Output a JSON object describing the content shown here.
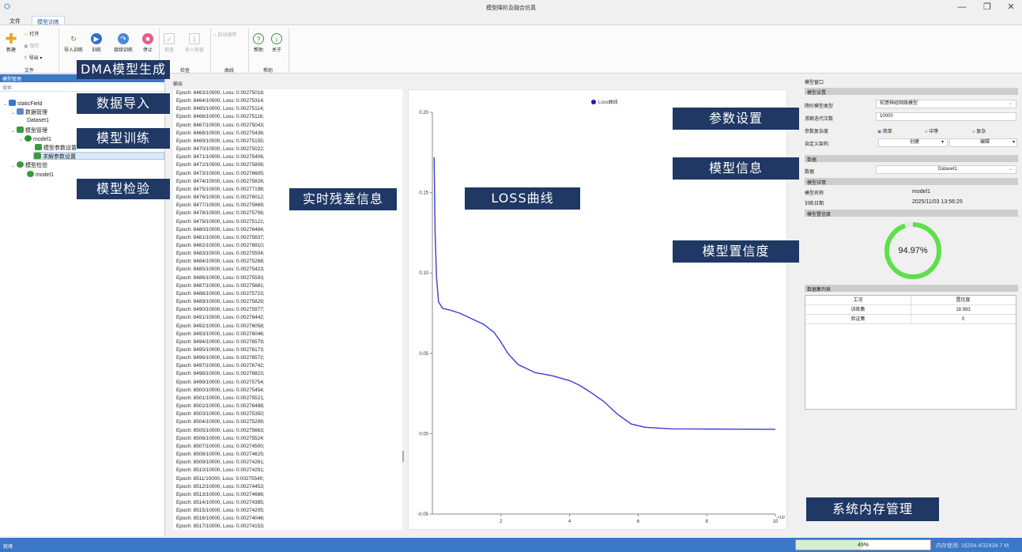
{
  "window": {
    "title": "模型降阶及融合仿真",
    "minimize": "—",
    "maximize": "❐",
    "close": "✕"
  },
  "menu": {
    "tabs": [
      "文件",
      "模型训练"
    ]
  },
  "ribbon": {
    "new": "新建",
    "open": "打开",
    "save": "保存",
    "export": "导出",
    "file_group": "文件",
    "import_train": "导入训练",
    "train": "训练",
    "continue_train": "接续训练",
    "stop": "停止",
    "check": "检查",
    "import_check": "导入检查",
    "check_group": "检查",
    "auto_refresh": "自动调参",
    "curve_group": "曲线",
    "help": "帮助",
    "about": "关于",
    "help_group": "帮助"
  },
  "left_panel": {
    "title": "模型管理",
    "search_placeholder": "搜索",
    "tree": [
      "staticField",
      "数据管理",
      "Dataset1",
      "模型管理",
      "model1",
      "模型参数设置",
      "求解参数设置",
      "模型检验",
      "model1"
    ]
  },
  "output": {
    "title": "输出",
    "lines": [
      "Epoch: 8463/10000, Loss: 0.00275018;",
      "Epoch: 8464/10000, Loss: 0.00275314;",
      "Epoch: 8465/10000, Loss: 0.00275114;",
      "Epoch: 8466/10000, Loss: 0.00275116;",
      "Epoch: 8467/10000, Loss: 0.00275043;",
      "Epoch: 8468/10000, Loss: 0.00275436;",
      "Epoch: 8469/10000, Loss: 0.00275155;",
      "Epoch: 8470/10000, Loss: 0.00275022;",
      "Epoch: 8471/10000, Loss: 0.00275406;",
      "Epoch: 8472/10000, Loss: 0.00275806;",
      "Epoch: 8473/10000, Loss: 0.00276605;",
      "Epoch: 8474/10000, Loss: 0.00275826;",
      "Epoch: 8475/10000, Loss: 0.00277198;",
      "Epoch: 8476/10000, Loss: 0.00276012;",
      "Epoch: 8477/10000, Loss: 0.00275869;",
      "Epoch: 8478/10000, Loss: 0.00275706;",
      "Epoch: 8479/10000, Loss: 0.00275121;",
      "Epoch: 8480/10000, Loss: 0.00276484;",
      "Epoch: 8481/10000, Loss: 0.00275637;",
      "Epoch: 8482/10000, Loss: 0.00276910;",
      "Epoch: 8483/10000, Loss: 0.00275504;",
      "Epoch: 8484/10000, Loss: 0.00275268;",
      "Epoch: 8485/10000, Loss: 0.00275423;",
      "Epoch: 8486/10000, Loss: 0.00275593;",
      "Epoch: 8487/10000, Loss: 0.00275681;",
      "Epoch: 8488/10000, Loss: 0.00275723;",
      "Epoch: 8489/10000, Loss: 0.00275829;",
      "Epoch: 8490/10000, Loss: 0.00275977;",
      "Epoch: 8491/10000, Loss: 0.00276442;",
      "Epoch: 8492/10000, Loss: 0.00276058;",
      "Epoch: 8493/10000, Loss: 0.00276046;",
      "Epoch: 8494/10000, Loss: 0.00276579;",
      "Epoch: 8495/10000, Loss: 0.00276173;",
      "Epoch: 8496/10000, Loss: 0.00276572;",
      "Epoch: 8497/10000, Loss: 0.00276742;",
      "Epoch: 8498/10000, Loss: 0.00276823;",
      "Epoch: 8499/10000, Loss: 0.00275754;",
      "Epoch: 8500/10000, Loss: 0.00275454;",
      "Epoch: 8501/10000, Loss: 0.00275521;",
      "Epoch: 8502/10000, Loss: 0.00276488;",
      "Epoch: 8503/10000, Loss: 0.00275350;",
      "Epoch: 8504/10000, Loss: 0.00275299;",
      "Epoch: 8505/10000, Loss: 0.00275663;",
      "Epoch: 8506/10000, Loss: 0.00275524;",
      "Epoch: 8507/10000, Loss: 0.00274500;",
      "Epoch: 8508/10000, Loss: 0.00274625;",
      "Epoch: 8509/10000, Loss: 0.00274261;",
      "Epoch: 8510/10000, Loss: 0.00274291;",
      "Epoch: 8511/10000, Loss: 0.00275540;",
      "Epoch: 8512/10000, Loss: 0.00274453;",
      "Epoch: 8513/10000, Loss: 0.00274686;",
      "Epoch: 8514/10000, Loss: 0.00274385;",
      "Epoch: 8515/10000, Loss: 0.00274205;",
      "Epoch: 8516/10000, Loss: 0.00274046;",
      "Epoch: 8517/10000, Loss: 0.00274153;"
    ]
  },
  "chart": {
    "legend": "Loss曲线",
    "yticks": [
      "0.20",
      "0.15",
      "0.10",
      "0.05",
      "0.00",
      "-0.05"
    ],
    "xticks": [
      "2",
      "4",
      "6",
      "8",
      "10"
    ],
    "xexp": "×10³",
    "line_color": "#3b3bd6"
  },
  "chart_data": {
    "type": "line",
    "series": [
      {
        "name": "Loss曲线",
        "x": [
          0.05,
          0.08,
          0.12,
          0.18,
          0.3,
          0.5,
          0.8,
          1.2,
          1.5,
          1.8,
          2.0,
          2.2,
          2.5,
          3.0,
          3.5,
          4.0,
          4.3,
          4.6,
          5.0,
          5.4,
          5.8,
          6.2,
          6.6,
          7.0,
          8.0,
          9.0,
          10.0
        ],
        "y": [
          0.172,
          0.125,
          0.098,
          0.082,
          0.078,
          0.077,
          0.075,
          0.071,
          0.068,
          0.063,
          0.057,
          0.05,
          0.043,
          0.038,
          0.036,
          0.033,
          0.03,
          0.026,
          0.02,
          0.012,
          0.006,
          0.004,
          0.0035,
          0.003,
          0.0029,
          0.0028,
          0.00275
        ]
      }
    ],
    "xlim": [
      0,
      10
    ],
    "ylim": [
      -0.05,
      0.2
    ],
    "grid": false,
    "legend_position": "top"
  },
  "right_panel": {
    "window_title": "模型窗口",
    "model_settings": "模型设置",
    "reduce_type_label": "降阶模型类型",
    "reduce_type_value": "前馈神经网络模型",
    "iter_label": "求解迭代次数",
    "iter_value": "10000",
    "complexity_label": "参数复杂度",
    "complexity_options": [
      "简单",
      "中等",
      "复杂"
    ],
    "custom_arch_label": "自定义架构",
    "create_btn": "创建",
    "edit_btn": "编辑",
    "data_section": "数据",
    "data_label": "数据",
    "data_value": "Dataset1",
    "model_detail": "模型详情",
    "model_name_label": "模型名称",
    "model_name_value": "model1",
    "train_date_label": "训练日期",
    "train_date_value": "2025/11/03 13:56:25",
    "confidence_section": "模型置信度",
    "confidence_value": "94.97%",
    "confidence_fraction": 0.9497,
    "dataset_list": "数据集列表",
    "table_headers": [
      "工况",
      "置信度"
    ],
    "table_rows": [
      [
        "训练集",
        "18.993"
      ],
      [
        "验证集",
        "0"
      ]
    ]
  },
  "callouts": {
    "dma": "DMA模型生成",
    "import": "数据导入",
    "train": "模型训练",
    "check": "模型检验",
    "residual": "实时残差信息",
    "loss": "LOSS曲线",
    "params": "参数设置",
    "info": "模型信息",
    "confidence": "模型置信度",
    "memory": "系统内存管理"
  },
  "status": {
    "text": "就绪",
    "mem_pct": "49%",
    "mem_fraction": 0.49,
    "mem_text": "内存使用: 16204.4/32434.7 M"
  },
  "colors": {
    "accent": "#3b78c8",
    "callout": "#1f3864",
    "ring": "#5ee04a"
  }
}
